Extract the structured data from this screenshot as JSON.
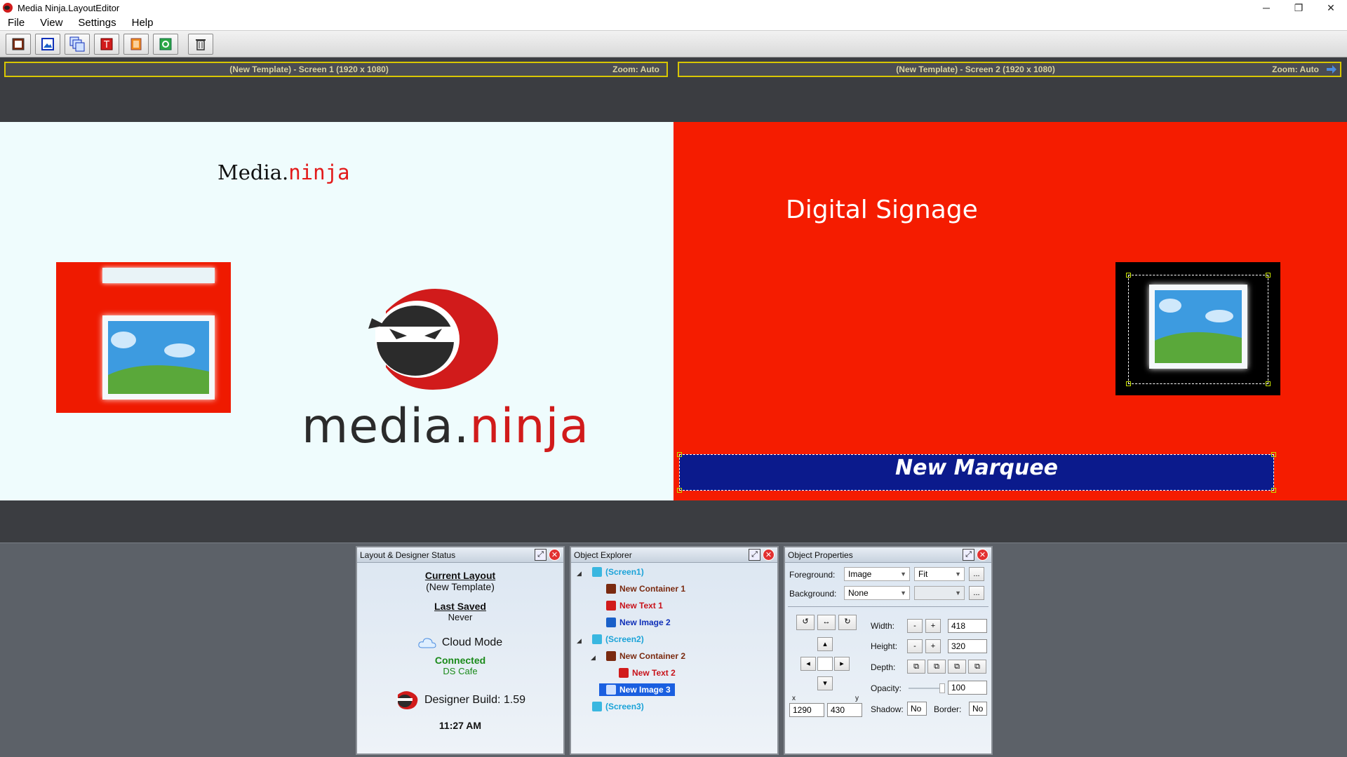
{
  "window": {
    "title": "Media Ninja.LayoutEditor"
  },
  "menu": [
    "File",
    "View",
    "Settings",
    "Help"
  ],
  "toolbar": {
    "icons": [
      "container-icon",
      "image-icon",
      "multi-image-icon",
      "text-icon",
      "book-icon",
      "web-icon",
      "trash-icon"
    ]
  },
  "screens": [
    {
      "title": "(New Template) - Screen 1  (1920 x 1080)",
      "zoom": "Zoom: Auto"
    },
    {
      "title": "(New Template) - Screen 2  (1920 x 1080)",
      "zoom": "Zoom: Auto"
    }
  ],
  "canvas": {
    "screen1": {
      "text_part1": "Media.",
      "text_part2": "ninja",
      "logo_word1": "media.",
      "logo_word2": "ninja"
    },
    "screen2": {
      "text": "Digital Signage",
      "marquee": "New Marquee"
    }
  },
  "status_panel": {
    "title": "Layout & Designer Status",
    "current_layout_label": "Current Layout",
    "current_layout_value": "(New Template)",
    "last_saved_label": "Last Saved",
    "last_saved_value": "Never",
    "cloud_label": "Cloud Mode",
    "connection": "Connected",
    "server": "DS Cafe",
    "build": "Designer Build: 1.59",
    "time": "11:27 AM"
  },
  "explorer": {
    "title": "Object Explorer",
    "items": [
      "(Screen1)",
      "New Container 1",
      "New Text 1",
      "New Image 2",
      "(Screen2)",
      "New Container 2",
      "New Text 2",
      "New Image 3",
      "(Screen3)"
    ]
  },
  "properties": {
    "title": "Object Properties",
    "foreground_label": "Foreground:",
    "foreground_value": "Image",
    "fit_value": "Fit",
    "background_label": "Background:",
    "background_value": "None",
    "ellipsis": "...",
    "width_label": "Width:",
    "width_value": "418",
    "height_label": "Height:",
    "height_value": "320",
    "depth_label": "Depth:",
    "opacity_label": "Opacity:",
    "opacity_value": "100",
    "x_label": "x",
    "y_label": "y",
    "x_value": "1290",
    "y_value": "430",
    "shadow_label": "Shadow:",
    "shadow_value": "No",
    "border_label": "Border:",
    "border_value": "No",
    "minus": "-",
    "plus": "+"
  },
  "colors": {
    "accent_red": "#f51c00",
    "marquee_blue": "#0b1a8c",
    "screen1_bg": "#effcfd",
    "header_border": "#d8c600"
  }
}
